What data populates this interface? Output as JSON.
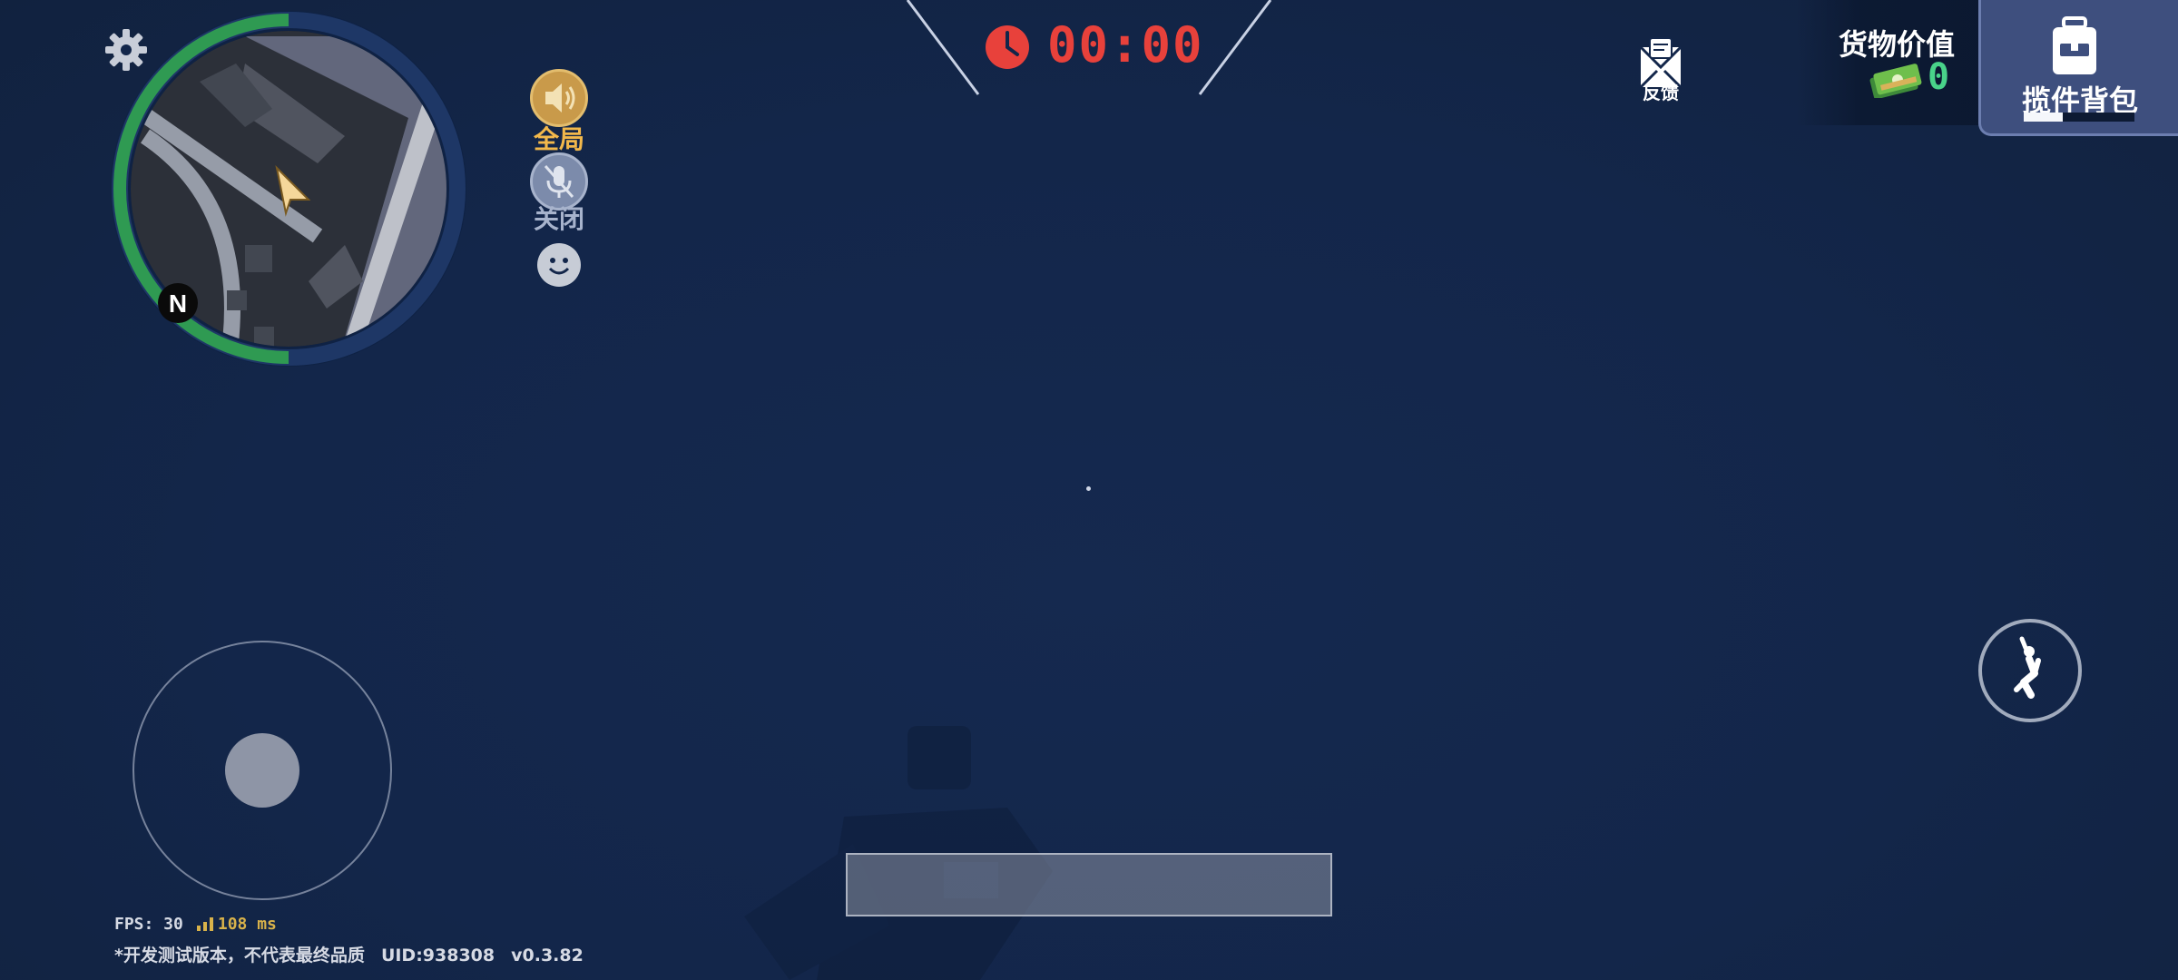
{
  "hud": {
    "timer": "00:00",
    "voice": {
      "global_label": "全局",
      "mic_label": "关闭"
    },
    "feedback_label": "反馈",
    "cargo": {
      "title": "货物价值",
      "value": "0"
    },
    "backpack": {
      "label": "揽件背包",
      "fill_fraction": 0.35
    },
    "minimap": {
      "north_label": "N",
      "ring_health_fraction": 0.5
    },
    "stats": {
      "fps": "FPS: 30",
      "ping": "108 ms",
      "build_notice": "*开发测试版本，不代表最终品质",
      "uid": "UID:938308",
      "version": "v0.3.82"
    }
  },
  "colors": {
    "timer": "#e8413b",
    "cargo_value": "#49d38a",
    "voice_active": "#f2b84b",
    "minimap_ring": "#2f9a52",
    "background": "#13264a"
  },
  "icons": [
    "gear-icon",
    "speaker-icon",
    "mic-off-icon",
    "smiley-icon",
    "clock-icon",
    "feedback-icon",
    "money-icon",
    "backpack-icon",
    "jump-icon"
  ]
}
